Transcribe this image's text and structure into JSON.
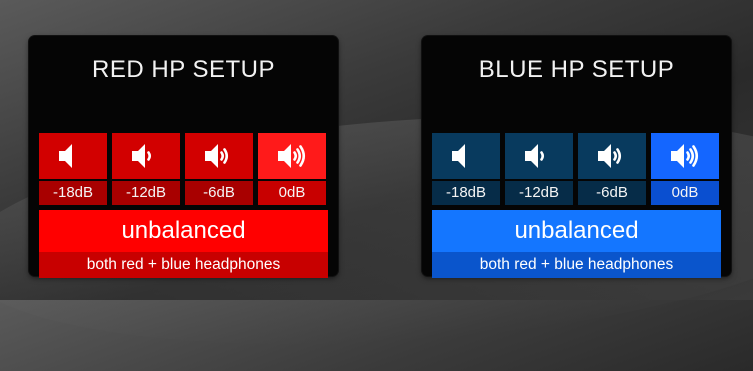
{
  "red_panel": {
    "title": "RED HP SETUP",
    "volume_buttons": [
      {
        "label": "-18dB",
        "icon": "speaker-0-waves-icon",
        "active": false
      },
      {
        "label": "-12dB",
        "icon": "speaker-1-wave-icon",
        "active": false
      },
      {
        "label": "-6dB",
        "icon": "speaker-2-waves-icon",
        "active": false
      },
      {
        "label": "0dB",
        "icon": "speaker-3-waves-icon",
        "active": true
      }
    ],
    "mode": "unbalanced",
    "mode_sub": "both red + blue headphones",
    "colors": {
      "button_top": "#d20000",
      "button_label": "#a80000",
      "active_top": "#ff1a1a",
      "active_label": "#c80000",
      "mode_top": "#ff0000",
      "mode_sub": "#c80000"
    }
  },
  "blue_panel": {
    "title": "BLUE HP SETUP",
    "volume_buttons": [
      {
        "label": "-18dB",
        "icon": "speaker-0-waves-icon",
        "active": false
      },
      {
        "label": "-12dB",
        "icon": "speaker-1-wave-icon",
        "active": false
      },
      {
        "label": "-6dB",
        "icon": "speaker-2-waves-icon",
        "active": false
      },
      {
        "label": "0dB",
        "icon": "speaker-3-waves-icon",
        "active": true
      }
    ],
    "mode": "unbalanced",
    "mode_sub": "both red + blue headphones",
    "colors": {
      "button_top": "#083a5e",
      "button_label": "#062c48",
      "active_top": "#1466ff",
      "active_label": "#0a4fd0",
      "mode_top": "#1476ff",
      "mode_sub": "#0a55cc"
    }
  }
}
